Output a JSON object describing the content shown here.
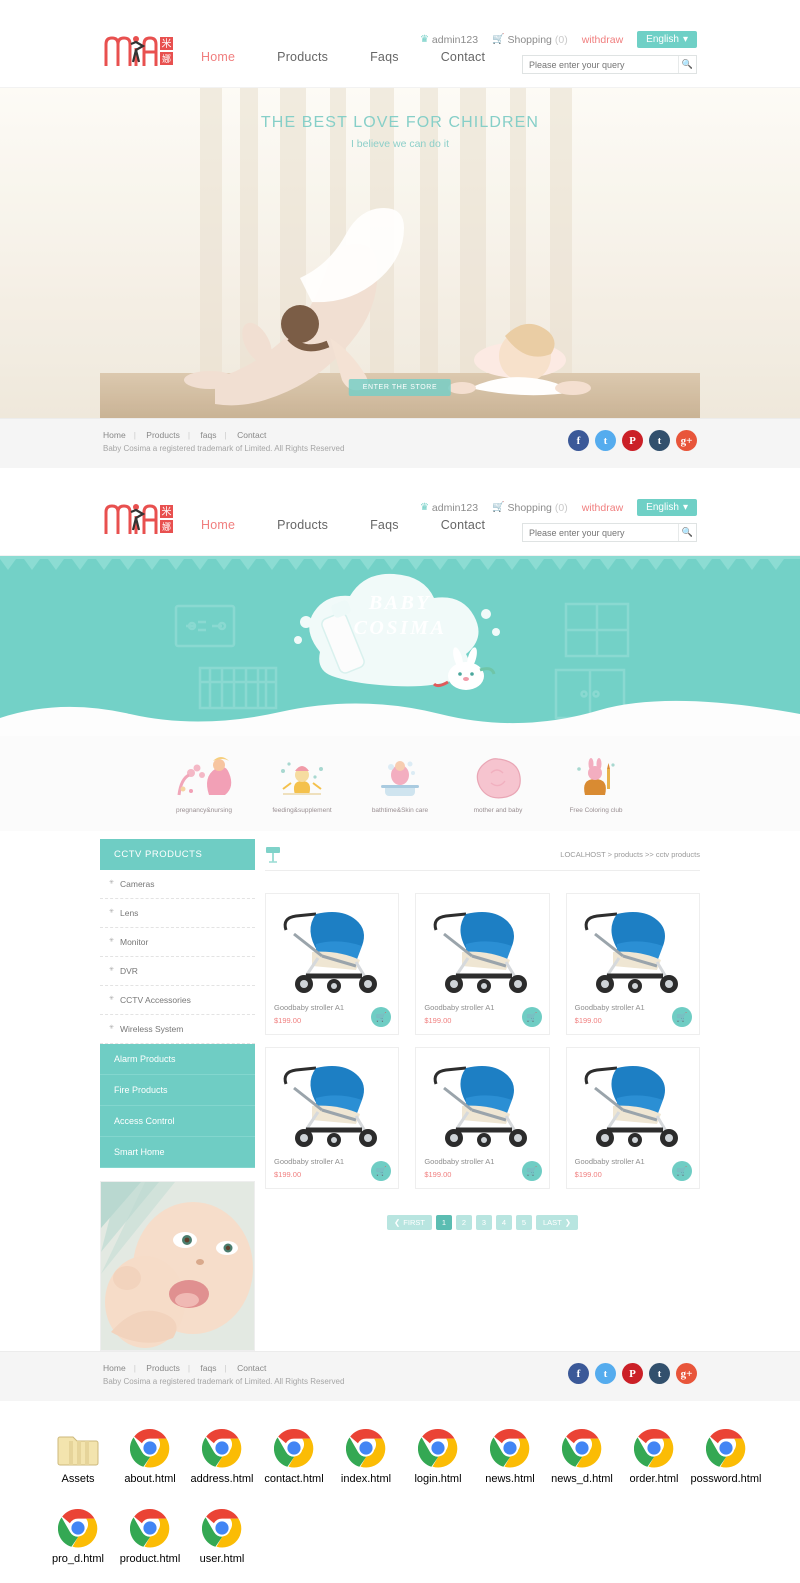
{
  "header": {
    "logo_alt": "MINA",
    "nav": [
      {
        "label": "Home",
        "active": true
      },
      {
        "label": "Products",
        "active": false
      },
      {
        "label": "Faqs",
        "active": false
      },
      {
        "label": "Contact",
        "active": false
      }
    ],
    "account": "admin123",
    "shopping": "Shopping",
    "shopping_count": "(0)",
    "withdraw": "withdraw",
    "language": "English",
    "search_placeholder": "Please enter your query"
  },
  "hero": {
    "title": "THE BEST LOVE FOR CHILDREN",
    "subtitle": "I believe we can do it",
    "cta": "ENTER THE STORE"
  },
  "footer": {
    "links": [
      "Home",
      "Products",
      "faqs",
      "Contact"
    ],
    "copyright": "Baby Cosima a registered trademark of Limited. All Rights Reserved",
    "socials": [
      "facebook-icon",
      "twitter-icon",
      "pinterest-icon",
      "tumblr-icon",
      "googleplus-icon"
    ]
  },
  "banner": {
    "line1": "BABY",
    "line2": "COSIMA"
  },
  "categories": [
    {
      "label": "pregnancy&nursing",
      "icon": "pregnancy-icon"
    },
    {
      "label": "feeding&supplement",
      "icon": "feeding-icon"
    },
    {
      "label": "bathtime&Skin care",
      "icon": "bathtime-icon"
    },
    {
      "label": "mother and baby",
      "icon": "mother-baby-icon"
    },
    {
      "label": "Free Coloring club",
      "icon": "coloring-icon"
    }
  ],
  "sidebar": {
    "title": "CCTV PRODUCTS",
    "sub_items": [
      "Cameras",
      "Lens",
      "Monitor",
      "DVR",
      "CCTV Accessories",
      "Wireless System"
    ],
    "blocks": [
      "Alarm Products",
      "Fire Products",
      "Access Control",
      "Smart Home"
    ],
    "promo_alt": "baby photo"
  },
  "main": {
    "breadcrumb": "LOCALHOST > products >> cctv products",
    "products": [
      {
        "name": "Goodbaby stroller A1",
        "price": "$199.00"
      },
      {
        "name": "Goodbaby stroller A1",
        "price": "$199.00"
      },
      {
        "name": "Goodbaby stroller A1",
        "price": "$199.00"
      },
      {
        "name": "Goodbaby stroller A1",
        "price": "$199.00"
      },
      {
        "name": "Goodbaby stroller A1",
        "price": "$199.00"
      },
      {
        "name": "Goodbaby stroller A1",
        "price": "$199.00"
      }
    ],
    "pagination": {
      "first": "FIRST",
      "pages": [
        "1",
        "2",
        "3",
        "4",
        "5"
      ],
      "last": "LAST",
      "active": "1"
    }
  },
  "desktop": {
    "icons": [
      {
        "name": "Assets",
        "type": "folder"
      },
      {
        "name": "about.html",
        "type": "chrome"
      },
      {
        "name": "address.html",
        "type": "chrome"
      },
      {
        "name": "contact.html",
        "type": "chrome"
      },
      {
        "name": "index.html",
        "type": "chrome"
      },
      {
        "name": "login.html",
        "type": "chrome"
      },
      {
        "name": "news.html",
        "type": "chrome"
      },
      {
        "name": "news_d.html",
        "type": "chrome"
      },
      {
        "name": "order.html",
        "type": "chrome"
      },
      {
        "name": "possword.html",
        "type": "chrome"
      },
      {
        "name": "pro_d.html",
        "type": "chrome"
      },
      {
        "name": "product.html",
        "type": "chrome"
      },
      {
        "name": "user.html",
        "type": "chrome"
      }
    ]
  },
  "colors": {
    "teal": "#6fcdc4",
    "pink": "#f07e7e",
    "banner_teal": "#73d1c7"
  }
}
